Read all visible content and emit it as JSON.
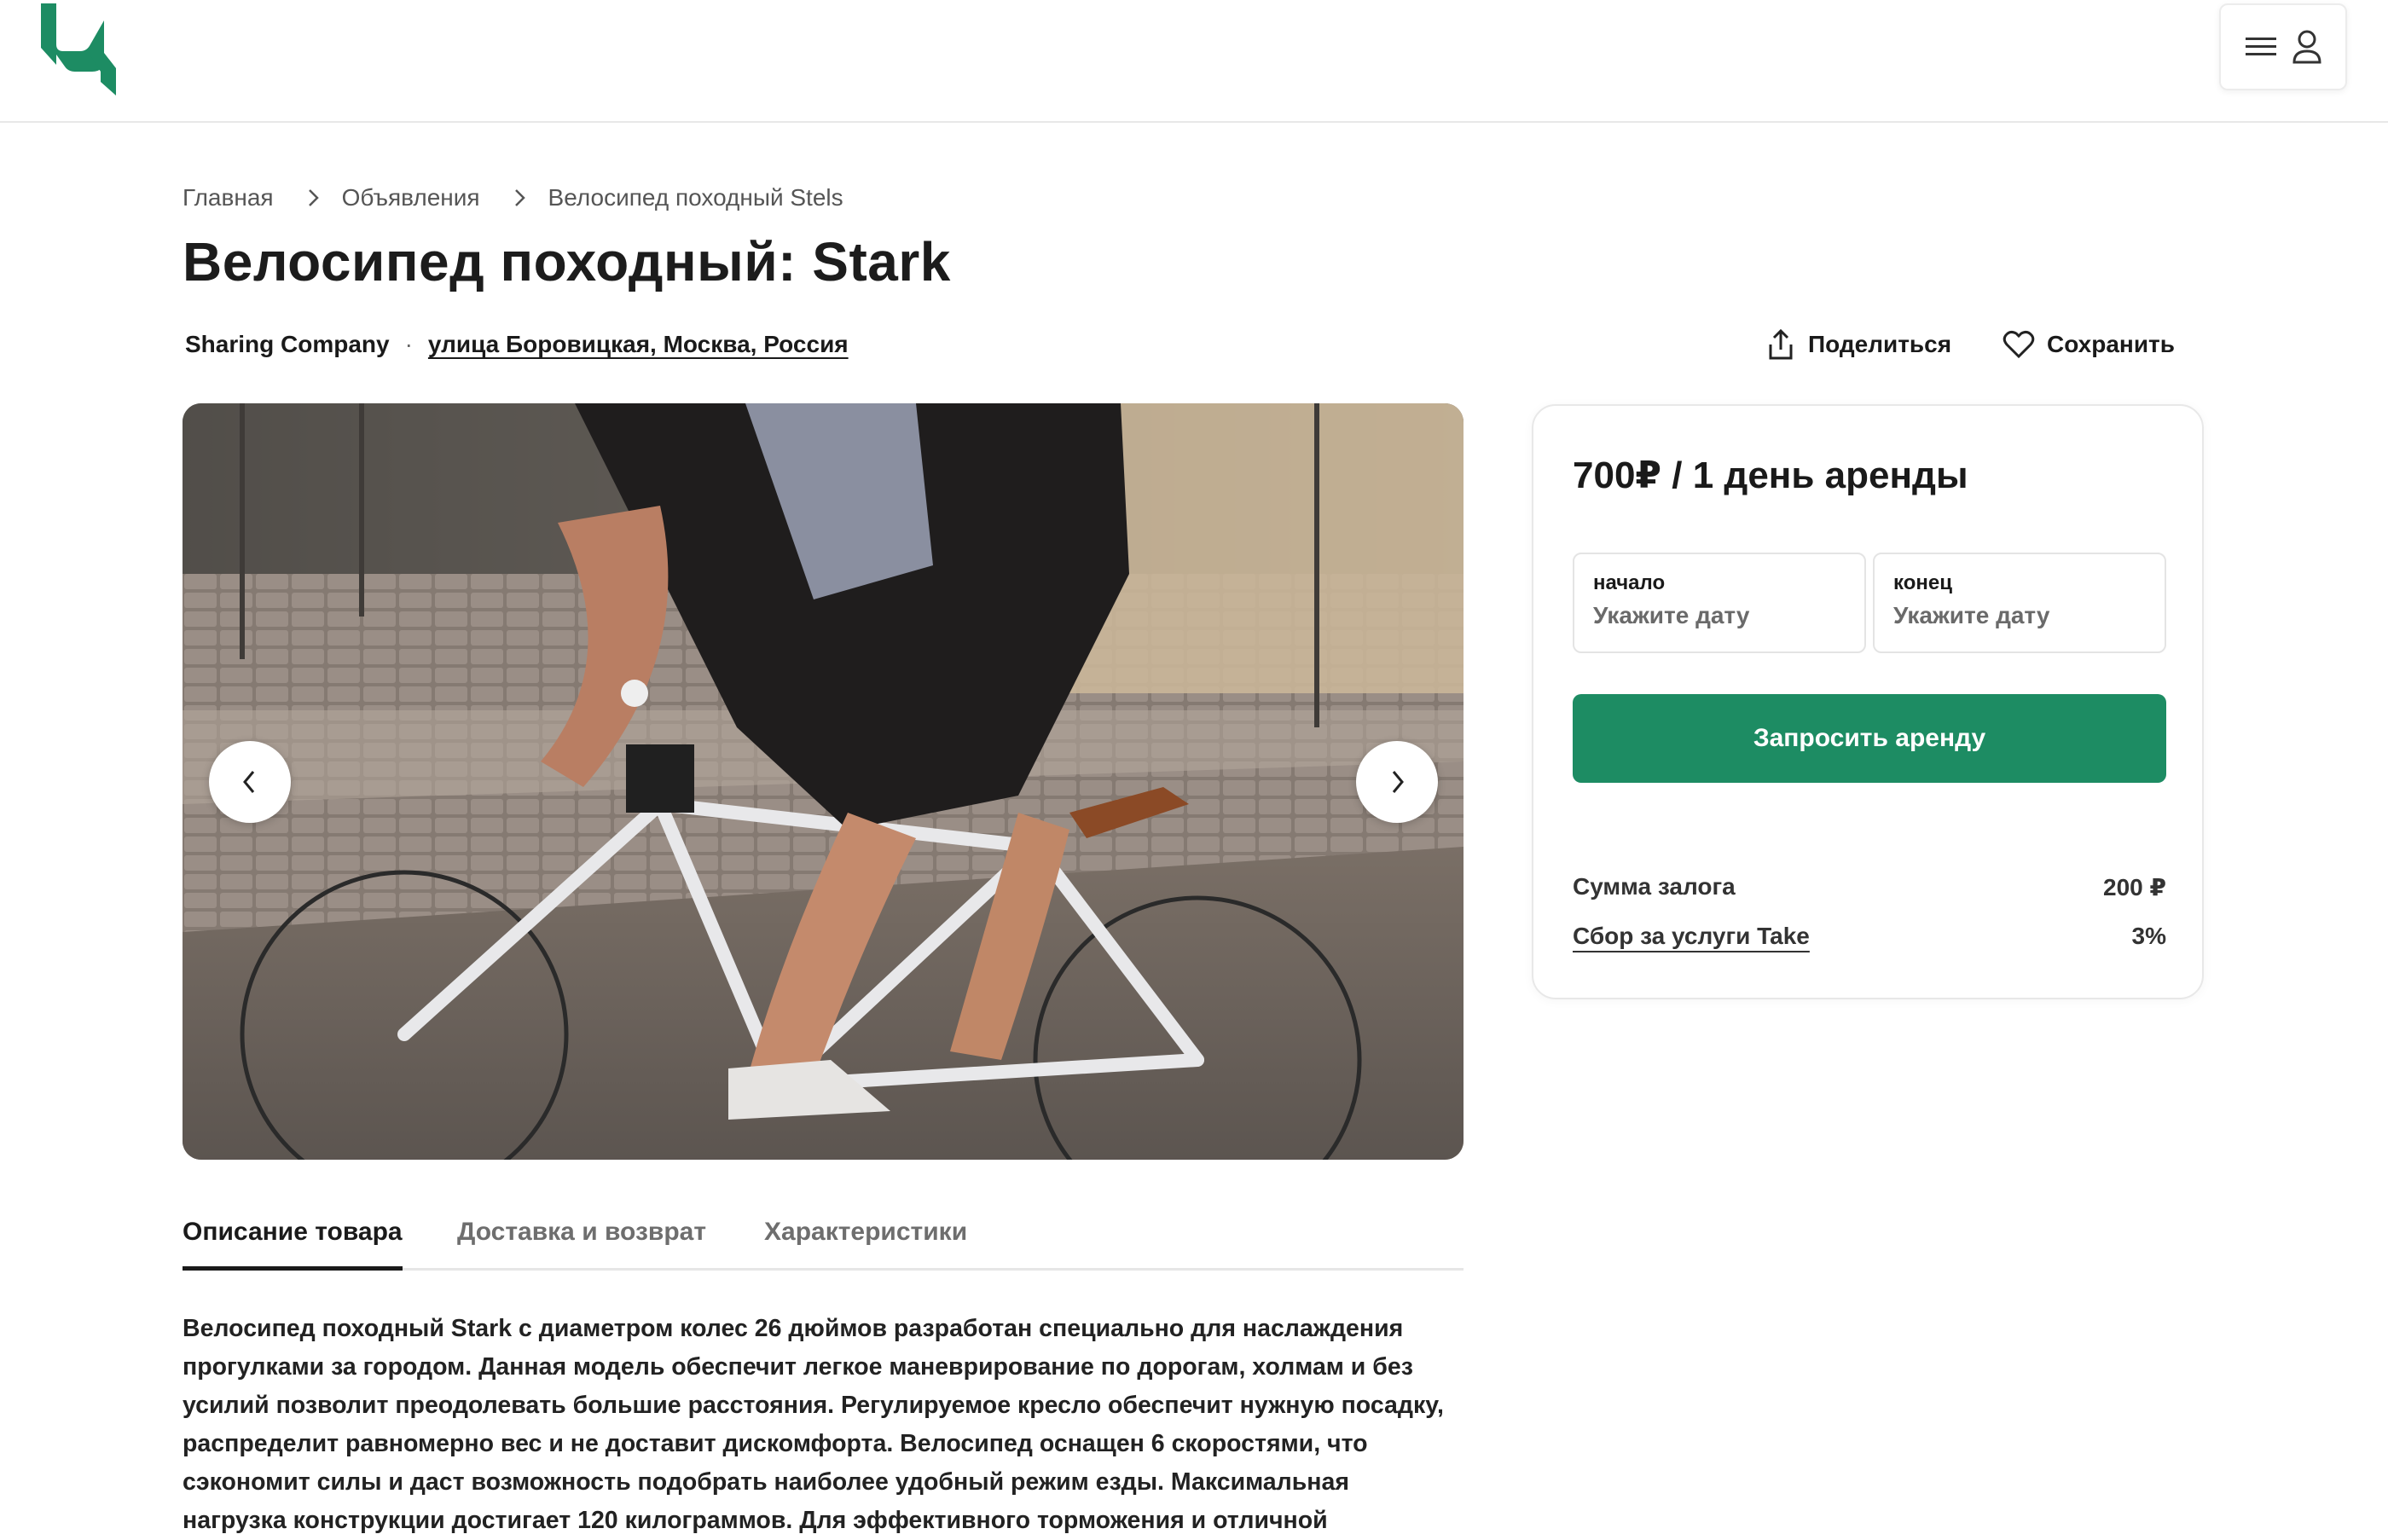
{
  "header": {
    "logo_icon": "brand-logo",
    "menu_icon": "hamburger-icon",
    "user_icon": "user-icon",
    "brand_color": "#1d8c63"
  },
  "breadcrumb": {
    "items": [
      "Главная",
      "Объявления",
      "Велосипед походный Stels"
    ],
    "separator_icon": "chevron-right-icon"
  },
  "listing": {
    "title": "Велосипед походный: Stark",
    "company": "Sharing Company",
    "dot": "·",
    "address": "улица Боровицкая, Москва, Россия"
  },
  "actions": {
    "share_label": "Поделиться",
    "share_icon": "share-icon",
    "save_label": "Сохранить",
    "save_icon": "heart-icon"
  },
  "gallery": {
    "prev_icon": "chevron-left-icon",
    "next_icon": "chevron-right-icon"
  },
  "tabs": {
    "items": [
      "Описание товара",
      "Доставка и возврат",
      "Характеристики"
    ],
    "active": "Описание товара"
  },
  "description": {
    "text": "Велосипед походный Stark с диаметром колес 26 дюймов разработан специально для наслаждения\nпрогулками за городом. Данная модель обеспечит легкое маневрирование по дорогам, холмам и без\nусилий позволит преодолевать большие расстояния. Регулируемое кресло обеспечит нужную посадку,\nраспределит равномерно вес и не доставит дискомфорта. Велосипед оснащен 6 скоростями, что\nсэкономит силы и даст возможность подобрать наиболее удобный режим езды. Максимальная\nнагрузка конструкции достигает 120 килограммов. Для эффективного торможения и отличной"
  },
  "booking": {
    "price": "700₽ / 1 день аренды",
    "start_label": "начало",
    "start_placeholder": "Укажите дату",
    "end_label": "конец",
    "end_placeholder": "Укажите дату",
    "request_label": "Запросить аренду",
    "deposit_label": "Сумма залога",
    "deposit_value": "200 ₽",
    "fee_label": "Сбор за услуги Take",
    "fee_value": "3%"
  }
}
